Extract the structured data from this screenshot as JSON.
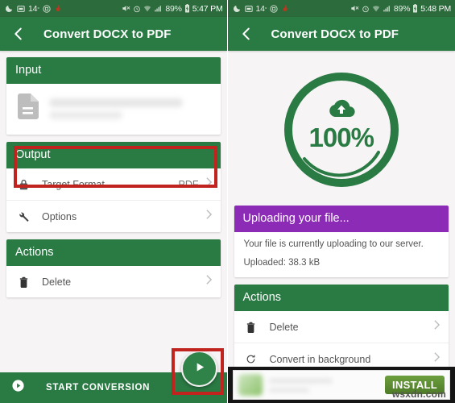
{
  "left": {
    "statusbar": {
      "icons_left": [
        "moon-icon",
        "screenshot-icon",
        "temperature-icon",
        "circle-at-icon",
        "app-icon"
      ],
      "temperature": "14",
      "icons_right": [
        "mute-icon",
        "alarm-icon",
        "wifi-icon",
        "signal-icon"
      ],
      "battery": "89%",
      "time": "5:47 PM"
    },
    "toolbar": {
      "back_icon": "back-arrow-icon",
      "title": "Convert DOCX to PDF"
    },
    "cards": {
      "input": {
        "title": "Input",
        "file_icon": "document-icon",
        "filename": ""
      },
      "output": {
        "title": "Output",
        "rows": [
          {
            "icon": "lock-icon",
            "label": "Target Format",
            "value": "PDF",
            "chevron": "chevron-right-icon"
          },
          {
            "icon": "wrench-icon",
            "label": "Options",
            "value": "",
            "chevron": "chevron-right-icon"
          }
        ]
      },
      "actions": {
        "title": "Actions",
        "rows": [
          {
            "icon": "trash-icon",
            "label": "Delete",
            "value": "",
            "chevron": "chevron-right-icon"
          }
        ]
      }
    },
    "bottom_bar": {
      "icon": "play-circle-icon",
      "label": "START CONVERSION"
    },
    "fab": {
      "icon": "play-icon"
    }
  },
  "right": {
    "statusbar": {
      "temperature": "14",
      "battery": "89%",
      "time": "5:48 PM"
    },
    "toolbar": {
      "back_icon": "back-arrow-icon",
      "title": "Convert DOCX to PDF"
    },
    "progress": {
      "icon": "cloud-upload-icon",
      "percent": "100%",
      "value": 100
    },
    "upload_card": {
      "title": "Uploading your file...",
      "description": "Your file is currently uploading to our server.",
      "uploaded": "Uploaded: 38.3 kB"
    },
    "actions": {
      "title": "Actions",
      "rows": [
        {
          "icon": "trash-icon",
          "label": "Delete",
          "chevron": "chevron-right-icon"
        },
        {
          "icon": "refresh-icon",
          "label": "Convert in background",
          "chevron": "chevron-right-icon"
        }
      ]
    },
    "ad": {
      "install_label": "INSTALL",
      "watermark": "wsxdn.com"
    }
  },
  "colors": {
    "toolbar_green": "#2a7a44",
    "status_green": "#2b6b3c",
    "card_header_green": "#2a7a44",
    "purple": "#8b2bb6",
    "annotation_red": "#c1241f",
    "page_background": "#f6f4f4"
  }
}
